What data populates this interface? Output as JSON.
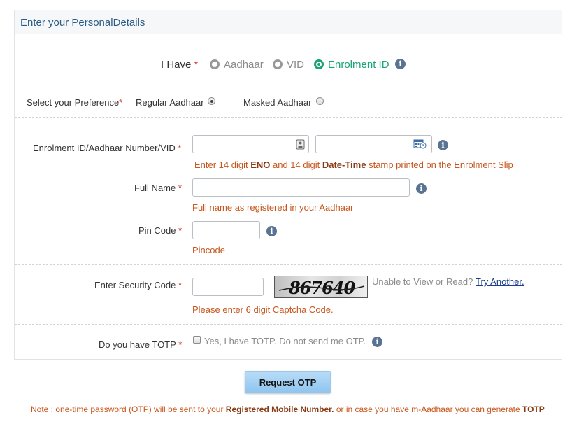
{
  "panel": {
    "title": "Enter your PersonalDetails"
  },
  "id_type": {
    "label": "I Have",
    "required_mark": "*",
    "options": [
      {
        "label": "Aadhaar",
        "selected": false
      },
      {
        "label": "VID",
        "selected": false
      },
      {
        "label": "Enrolment ID",
        "selected": true
      }
    ]
  },
  "preference": {
    "label": "Select your Preference",
    "required_mark": "*",
    "options": [
      {
        "label": "Regular Aadhaar",
        "selected": true
      },
      {
        "label": "Masked Aadhaar",
        "selected": false
      }
    ]
  },
  "enrolment": {
    "label": "Enrolment ID/Aadhaar Number/VID",
    "required_mark": "*",
    "eno_value": "",
    "datetime_value": "",
    "hint_pre": "Enter 14 digit ",
    "hint_b1": "ENO",
    "hint_mid": " and 14 digit ",
    "hint_b2": "Date-Time",
    "hint_post": " stamp printed on the Enrolment Slip"
  },
  "full_name": {
    "label": "Full Name",
    "required_mark": "*",
    "value": "",
    "hint": "Full name as registered in your Aadhaar"
  },
  "pin_code": {
    "label": "Pin Code",
    "required_mark": "*",
    "value": "",
    "hint": "Pincode"
  },
  "security": {
    "label": "Enter Security Code",
    "required_mark": "*",
    "value": "",
    "captcha_text": "867640",
    "unable_text": "Unable to View or Read?",
    "try_another": "Try Another.",
    "hint": "Please enter 6 digit Captcha Code."
  },
  "totp": {
    "label": "Do you have TOTP",
    "required_mark": "*",
    "checkbox_label": "Yes, I have TOTP. Do not send me OTP.",
    "checked": false
  },
  "request_otp_label": "Request OTP",
  "note": {
    "prefix": "Note : one-time password (OTP) will be sent to your ",
    "bold1": "Registered Mobile Number.",
    "middle": " or in case you have m-Aadhaar you can generate ",
    "bold2": "TOTP"
  },
  "info_glyph": "i",
  "colors": {
    "accent_green": "#1aa37a",
    "hint_orange": "#c8561c",
    "button_blue": "#8fc5f0",
    "info_icon": "#5a7393",
    "required_red": "#d9261c"
  },
  "icons": {
    "eno_field": "contact-card-icon",
    "datetime_field": "calendar-clock-icon",
    "info": "info-icon"
  }
}
